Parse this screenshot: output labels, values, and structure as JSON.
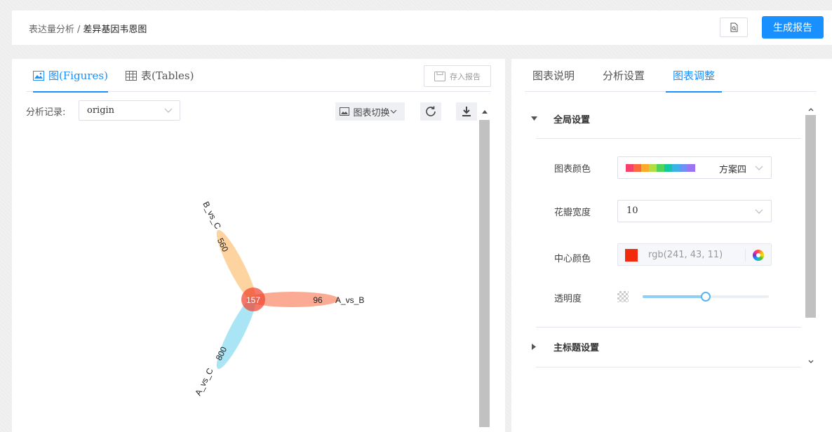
{
  "breadcrumb": {
    "parent": "表达量分析",
    "separator": "/",
    "current": "差异基因韦恩图"
  },
  "header": {
    "report_button": "生成报告"
  },
  "left": {
    "tabs": [
      {
        "label": "图(Figures)",
        "icon": "image-icon",
        "active": true
      },
      {
        "label": "表(Tables)",
        "icon": "table-icon",
        "active": false
      }
    ],
    "save_report": "存入报告",
    "record_label": "分析记录:",
    "record_value": "origin",
    "switch_chart": "图表切换",
    "icons": {
      "refresh": "refresh-icon",
      "download": "download-icon"
    }
  },
  "venn": {
    "center_value": "157",
    "petals": [
      {
        "name": "A_vs_B",
        "value": "96",
        "color": "#f98f70"
      },
      {
        "name": "B_vs_C",
        "value": "560",
        "color": "#fcc47f"
      },
      {
        "name": "A_vs_C",
        "value": "800",
        "color": "#8ddcf2"
      }
    ],
    "center_color": "#f1402b"
  },
  "right": {
    "tabs": [
      {
        "label": "图表说明",
        "active": false
      },
      {
        "label": "分析设置",
        "active": false
      },
      {
        "label": "图表调整",
        "active": true
      }
    ],
    "global_section": "全局设置",
    "chart_color_label": "图表颜色",
    "chart_color_scheme": "方案四",
    "swatches": [
      "#f5426c",
      "#f96a3c",
      "#fbab2c",
      "#b3dd45",
      "#4fd45a",
      "#14c7a4",
      "#3bb3e8",
      "#6e8ff4",
      "#9c74f2"
    ],
    "petal_width_label": "花瓣宽度",
    "petal_width_value": "10",
    "center_color_label": "中心颜色",
    "center_color_value": "rgb(241, 43, 11)",
    "center_color_hex": "#f12b0b",
    "opacity_label": "透明度",
    "opacity_value": 0.5,
    "title_section": "主标题设置"
  }
}
